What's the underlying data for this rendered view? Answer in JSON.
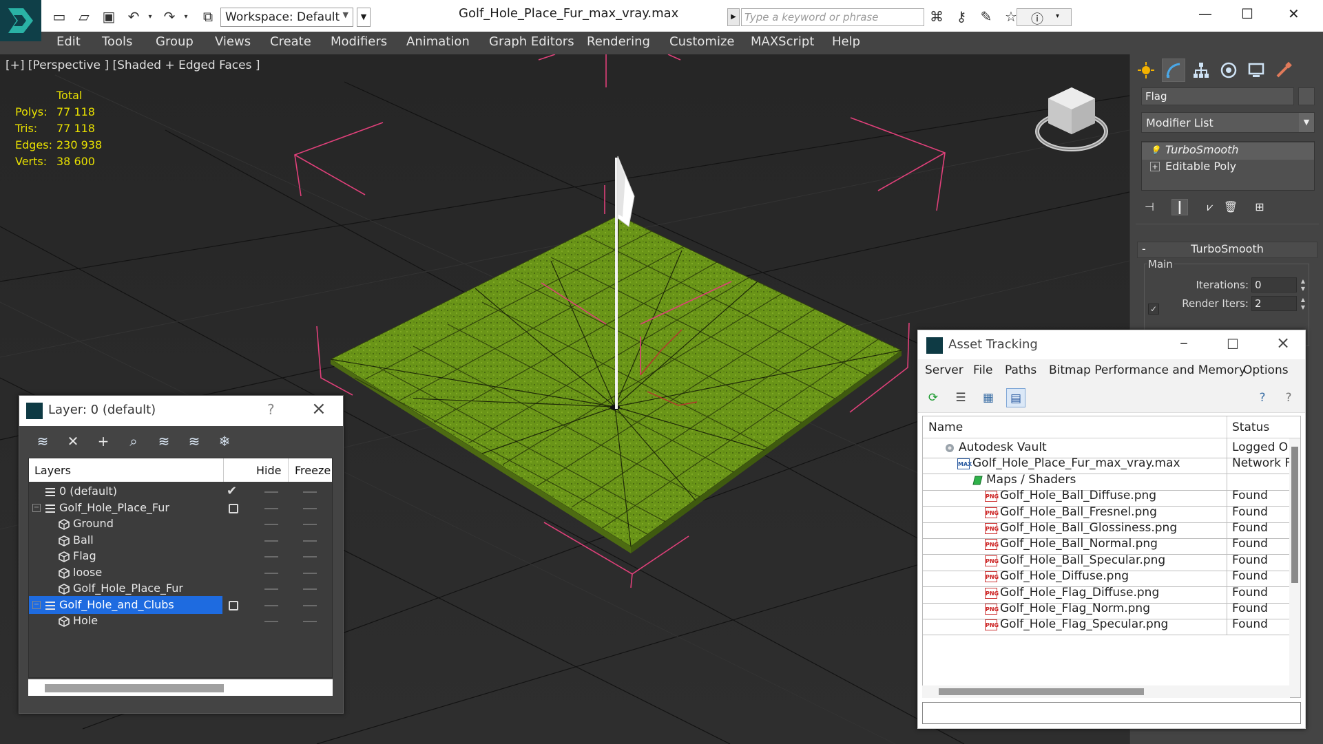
{
  "window": {
    "file_title": "Golf_Hole_Place_Fur_max_vray.max",
    "workspace_label": "Workspace: Default",
    "search_placeholder": "Type a keyword or phrase"
  },
  "menu": [
    "Edit",
    "Tools",
    "Group",
    "Views",
    "Create",
    "Modifiers",
    "Animation",
    "Graph Editors",
    "Rendering",
    "Customize",
    "MAXScript",
    "Help"
  ],
  "viewport": {
    "label": "[+] [Perspective ] [Shaded + Edged Faces ]",
    "stats_header": "Total",
    "stats": [
      {
        "key": "Polys:",
        "value": "77 118"
      },
      {
        "key": "Tris:",
        "value": "77 118"
      },
      {
        "key": "Edges:",
        "value": "230 938"
      },
      {
        "key": "Verts:",
        "value": "38 600"
      }
    ]
  },
  "command_panel": {
    "object_name": "Flag",
    "modifier_list": "Modifier List",
    "stack": [
      {
        "label": "TurboSmooth",
        "icon": "lightbulb-icon"
      },
      {
        "label": "Editable Poly",
        "icon": "plus-expand-icon"
      }
    ],
    "rollout_title": "TurboSmooth",
    "group_main": "Main",
    "iterations_label": "Iterations:",
    "iterations_value": "0",
    "render_iters_label": "Render Iters:",
    "render_iters_value": "2"
  },
  "layer_dialog": {
    "title": "Layer: 0 (default)",
    "help": "?",
    "columns": {
      "layers": "Layers",
      "hide": "Hide",
      "freeze": "Freeze"
    },
    "rows": [
      {
        "label": "0 (default)",
        "level": 0,
        "kind": "layer",
        "active": true
      },
      {
        "label": "Golf_Hole_Place_Fur",
        "level": 0,
        "kind": "layer",
        "expand": "−",
        "box": true
      },
      {
        "label": "Ground",
        "level": 1,
        "kind": "object"
      },
      {
        "label": "Ball",
        "level": 1,
        "kind": "object"
      },
      {
        "label": "Flag",
        "level": 1,
        "kind": "object"
      },
      {
        "label": "loose",
        "level": 1,
        "kind": "object"
      },
      {
        "label": "Golf_Hole_Place_Fur",
        "level": 1,
        "kind": "object"
      },
      {
        "label": "Golf_Hole_and_Clubs",
        "level": 0,
        "kind": "layer",
        "expand": "−",
        "box": true,
        "selected": true
      },
      {
        "label": "Hole",
        "level": 1,
        "kind": "object"
      }
    ]
  },
  "asset_dialog": {
    "title": "Asset Tracking",
    "menu": [
      "Server",
      "File",
      "Paths",
      "Bitmap Performance and Memory",
      "Options"
    ],
    "columns": {
      "name": "Name",
      "status": "Status"
    },
    "rows": [
      {
        "name": "Autodesk Vault",
        "status": "Logged O",
        "level": 0,
        "icon": "vault"
      },
      {
        "name": "Golf_Hole_Place_Fur_max_vray.max",
        "status": "Network F",
        "level": 1,
        "icon": "max"
      },
      {
        "name": "Maps / Shaders",
        "status": "",
        "level": 2,
        "icon": "maps"
      },
      {
        "name": "Golf_Hole_Ball_Diffuse.png",
        "status": "Found",
        "level": 3,
        "icon": "png"
      },
      {
        "name": "Golf_Hole_Ball_Fresnel.png",
        "status": "Found",
        "level": 3,
        "icon": "png"
      },
      {
        "name": "Golf_Hole_Ball_Glossiness.png",
        "status": "Found",
        "level": 3,
        "icon": "png"
      },
      {
        "name": "Golf_Hole_Ball_Normal.png",
        "status": "Found",
        "level": 3,
        "icon": "png"
      },
      {
        "name": "Golf_Hole_Ball_Specular.png",
        "status": "Found",
        "level": 3,
        "icon": "png"
      },
      {
        "name": "Golf_Hole_Diffuse.png",
        "status": "Found",
        "level": 3,
        "icon": "png"
      },
      {
        "name": "Golf_Hole_Flag_Diffuse.png",
        "status": "Found",
        "level": 3,
        "icon": "png"
      },
      {
        "name": "Golf_Hole_Flag_Norm.png",
        "status": "Found",
        "level": 3,
        "icon": "png"
      },
      {
        "name": "Golf_Hole_Flag_Specular.png",
        "status": "Found",
        "level": 3,
        "icon": "png"
      }
    ]
  },
  "icon_labels": {
    "png": "PNG",
    "max": "MAX"
  },
  "colors": {
    "accent_selection": "#1e6be0",
    "stats_text": "#e8e000",
    "selection_brackets": "#e0407a",
    "grass": "#6e9a1c"
  }
}
